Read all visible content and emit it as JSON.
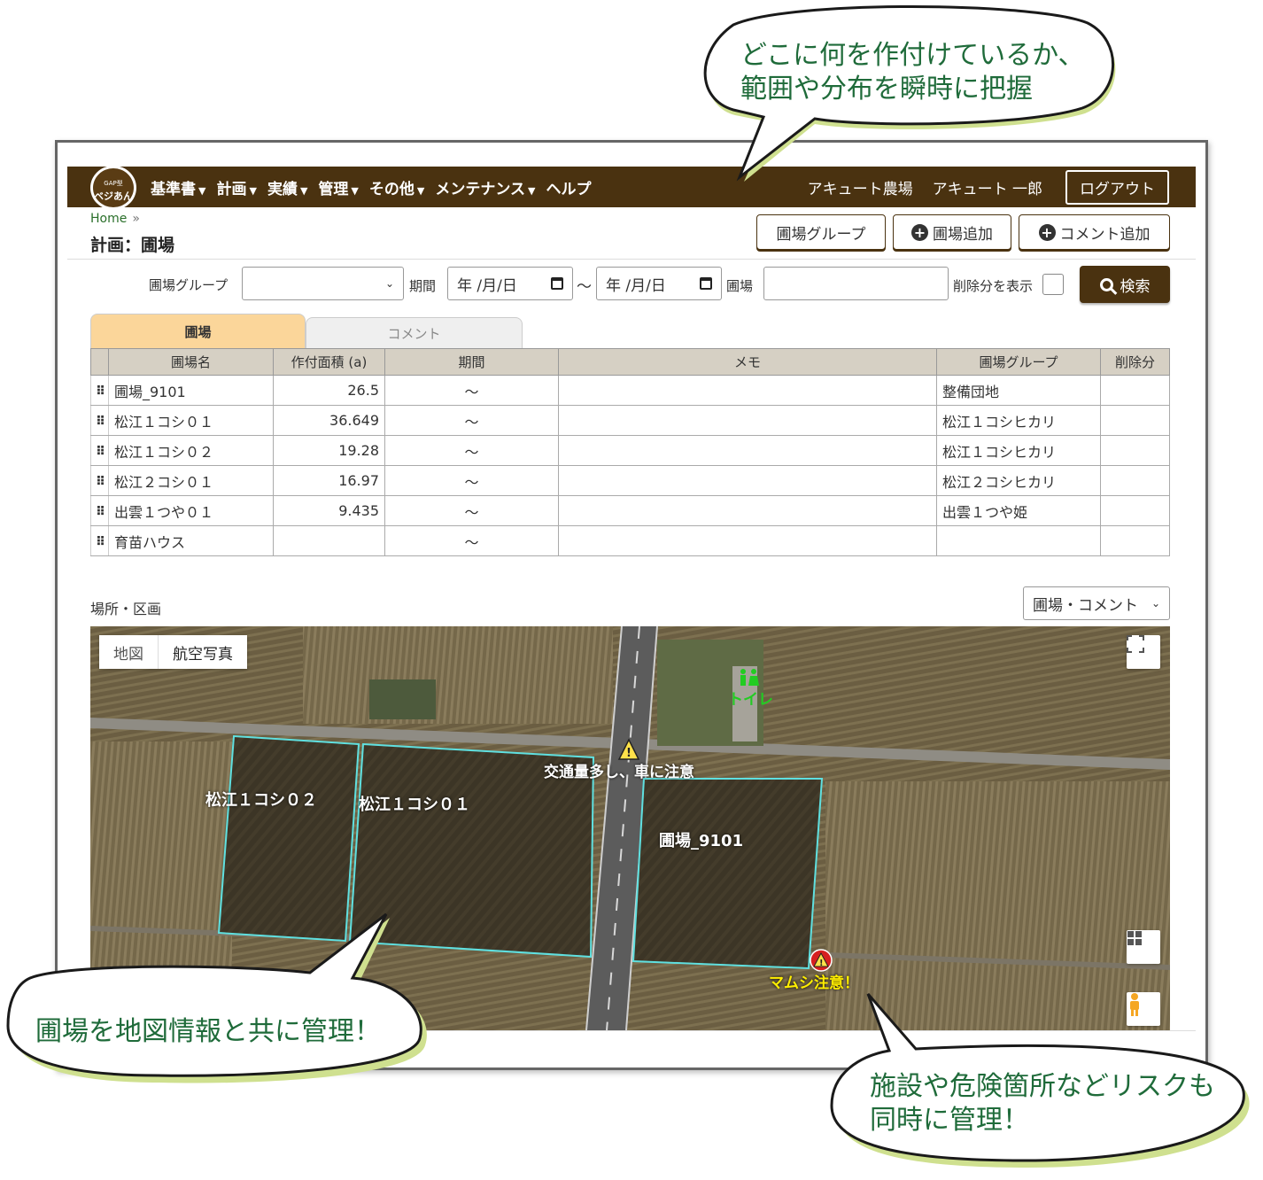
{
  "nav": {
    "logo_line1": "GAP型",
    "logo_line2": "ベジあん",
    "items": [
      {
        "label": "基準書",
        "caret": "▼"
      },
      {
        "label": "計画",
        "caret": "▼"
      },
      {
        "label": "実績",
        "caret": "▼"
      },
      {
        "label": "管理",
        "caret": "▼"
      },
      {
        "label": "その他",
        "caret": "▼"
      },
      {
        "label": "メンテナンス",
        "caret": "▼"
      },
      {
        "label": "ヘルプ",
        "caret": ""
      }
    ],
    "farm": "アキュート農場",
    "user": "アキュート 一郎",
    "logout": "ログアウト"
  },
  "breadcrumb": {
    "home": "Home",
    "sep": "»"
  },
  "page_title": "計画：圃場",
  "top_buttons": {
    "group": "圃場グループ",
    "add_field": "圃場追加",
    "add_comment": "コメント追加"
  },
  "search": {
    "group_label": "圃場グループ",
    "group_value": "",
    "period_label": "期間",
    "date_from": "年 /月/日",
    "tilde": "～",
    "date_to": "年 /月/日",
    "field_label": "圃場",
    "field_value": "",
    "show_deleted_label": "削除分を表示",
    "search_button": "検索"
  },
  "tabs": [
    {
      "label": "圃場",
      "active": true
    },
    {
      "label": "コメント",
      "active": false
    }
  ],
  "table": {
    "headers": [
      "圃場名",
      "作付面積 (a)",
      "期間",
      "メモ",
      "圃場グループ",
      "削除分"
    ],
    "handle": "⠿",
    "rows": [
      {
        "name": "圃場_9101",
        "area": "26.5",
        "period": "～",
        "memo": "",
        "group": "整備団地",
        "deleted": ""
      },
      {
        "name": "松江１コシ０１",
        "area": "36.649",
        "period": "～",
        "memo": "",
        "group": "松江１コシヒカリ",
        "deleted": ""
      },
      {
        "name": "松江１コシ０２",
        "area": "19.28",
        "period": "～",
        "memo": "",
        "group": "松江１コシヒカリ",
        "deleted": ""
      },
      {
        "name": "松江２コシ０１",
        "area": "16.97",
        "period": "～",
        "memo": "",
        "group": "松江２コシヒカリ",
        "deleted": ""
      },
      {
        "name": "出雲１つや０１",
        "area": "9.435",
        "period": "～",
        "memo": "",
        "group": "出雲１つや姫",
        "deleted": ""
      },
      {
        "name": "育苗ハウス",
        "area": "",
        "period": "～",
        "memo": "",
        "group": "",
        "deleted": ""
      }
    ]
  },
  "map": {
    "section_label": "場所・区画",
    "layer_select": "圃場・コメント",
    "type_map": "地図",
    "type_aerial": "航空写真",
    "field_labels": [
      "松江１コシ０２",
      "松江１コシ０１",
      "圃場_9101"
    ],
    "markers": {
      "toilet": "トイレ",
      "traffic": "交通量多し、車に注意",
      "snake": "マムシ注意！"
    },
    "colors": {
      "field_outline": "#5fe0e0",
      "toilet_text": "#22cc22",
      "snake_text": "#ffee00"
    }
  },
  "bubbles": {
    "top": [
      "どこに何を作付けているか、",
      "範囲や分布を瞬時に把握"
    ],
    "left": [
      "圃場を地図情報と共に管理！"
    ],
    "right": [
      "施設や危険箇所などリスクも",
      "同時に管理！"
    ]
  },
  "colors": {
    "nav_bg": "#4a3210",
    "tab_active": "#fbd69a",
    "bubble_text": "#1f6b3a",
    "bubble_fill": "#cfe08f"
  }
}
